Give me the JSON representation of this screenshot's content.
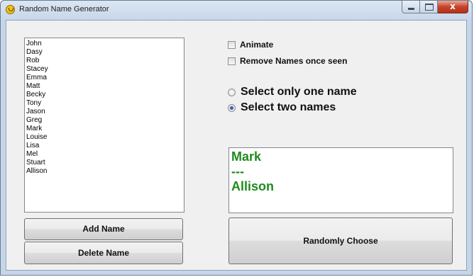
{
  "window": {
    "title": "Random Name Generator",
    "close_glyph": "x"
  },
  "names_list": {
    "items": [
      "John",
      "Dasy",
      "Rob",
      "Stacey",
      "Emma",
      "Matt",
      "Becky",
      "Tony",
      "Jason",
      "Greg",
      "Mark",
      "Louise",
      "Lisa",
      "Mel",
      "Stuart",
      "Allison"
    ]
  },
  "buttons": {
    "add_name": "Add Name",
    "delete_name": "Delete Name",
    "randomly_choose": "Randomly Choose"
  },
  "options": {
    "animate": {
      "label": "Animate",
      "checked": false
    },
    "remove_names": {
      "label": "Remove Names once seen",
      "checked": false
    }
  },
  "selection_mode": {
    "one_name": {
      "label": "Select only one name",
      "selected": false
    },
    "two_names": {
      "label": "Select two names",
      "selected": true
    }
  },
  "result": {
    "lines": [
      "Mark",
      "---",
      "Allison"
    ],
    "color": "#1f8b1f"
  }
}
